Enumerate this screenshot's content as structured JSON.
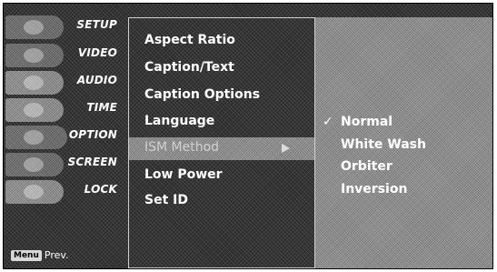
{
  "sidebar": {
    "categories": [
      {
        "label": "SETUP"
      },
      {
        "label": "VIDEO"
      },
      {
        "label": "AUDIO"
      },
      {
        "label": "TIME"
      },
      {
        "label": "OPTION"
      },
      {
        "label": "SCREEN"
      },
      {
        "label": "LOCK"
      }
    ],
    "footer": {
      "key_label": "Menu",
      "prev_label": "Prev."
    }
  },
  "submenu": {
    "items": [
      {
        "label": "Aspect Ratio"
      },
      {
        "label": "Caption/Text"
      },
      {
        "label": "Caption Options"
      },
      {
        "label": "Language"
      },
      {
        "label": "ISM Method"
      },
      {
        "label": "Low Power"
      },
      {
        "label": "Set ID"
      }
    ],
    "selected": "ISM Method"
  },
  "options": {
    "check_glyph": "✓",
    "items": [
      {
        "label": "Normal",
        "checked": true
      },
      {
        "label": "White Wash",
        "checked": false
      },
      {
        "label": "Orbiter",
        "checked": false
      },
      {
        "label": "Inversion",
        "checked": false
      }
    ]
  }
}
